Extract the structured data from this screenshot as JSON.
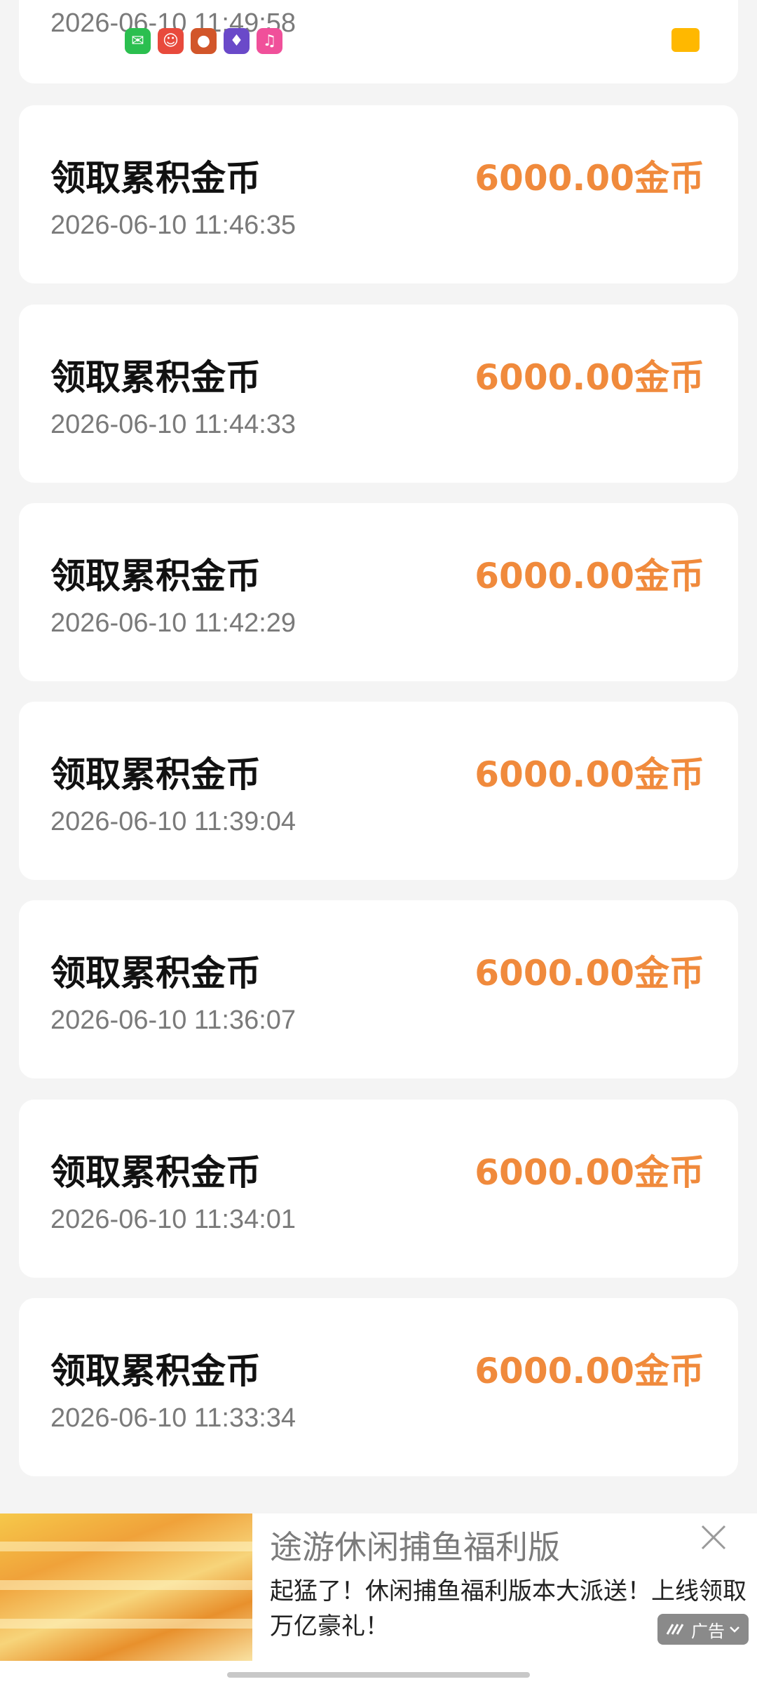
{
  "status_bar": {
    "apps": [
      {
        "name": "wechat-icon",
        "glyph": "✉",
        "color": "#2bbf4f"
      },
      {
        "name": "app-red-icon",
        "glyph": "☺",
        "color": "#e84a3c"
      },
      {
        "name": "app-orange-icon",
        "glyph": "●",
        "color": "#d2562a"
      },
      {
        "name": "app-game-icon",
        "glyph": "♦",
        "color": "#6a49c9"
      },
      {
        "name": "app-pink-icon",
        "glyph": "♫",
        "color": "#f0509a"
      }
    ],
    "battery_color": "#ffb800"
  },
  "records": [
    {
      "title": "",
      "time": "2026-06-10 11:49:58",
      "amount": ""
    },
    {
      "title": "领取累积金币",
      "time": "2026-06-10 11:46:35",
      "amount": "6000.00金币"
    },
    {
      "title": "领取累积金币",
      "time": "2026-06-10 11:44:33",
      "amount": "6000.00金币"
    },
    {
      "title": "领取累积金币",
      "time": "2026-06-10 11:42:29",
      "amount": "6000.00金币"
    },
    {
      "title": "领取累积金币",
      "time": "2026-06-10 11:39:04",
      "amount": "6000.00金币"
    },
    {
      "title": "领取累积金币",
      "time": "2026-06-10 11:36:07",
      "amount": "6000.00金币"
    },
    {
      "title": "领取累积金币",
      "time": "2026-06-10 11:34:01",
      "amount": "6000.00金币"
    },
    {
      "title": "领取累积金币",
      "time": "2026-06-10 11:33:34",
      "amount": "6000.00金币"
    }
  ],
  "ad": {
    "title": "途游休闲捕鱼福利版",
    "description": "起猛了！休闲捕鱼福利版本大派送！上线领取万亿豪礼！",
    "badge": "广告"
  },
  "colors": {
    "amount": "#f08a3c",
    "title": "#111111",
    "time": "#7a7a7a"
  }
}
